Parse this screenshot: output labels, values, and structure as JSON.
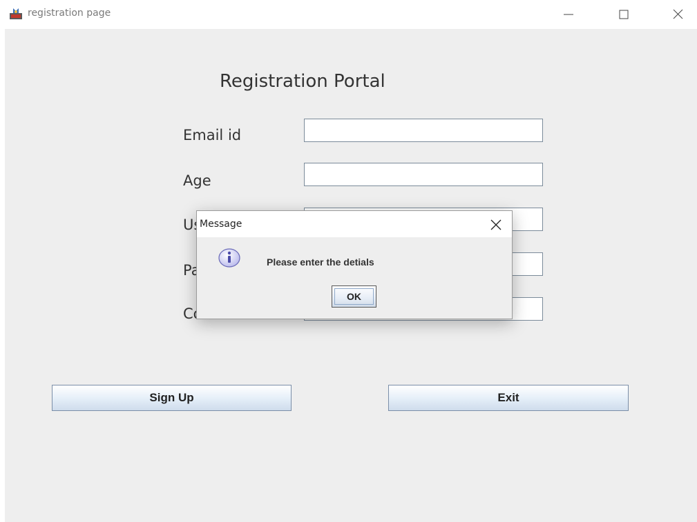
{
  "window": {
    "title": "registration page",
    "app_icon": "java-coffee-icon",
    "controls": [
      "minimize-icon",
      "maximize-icon",
      "close-icon"
    ]
  },
  "form": {
    "heading": "Registration Portal",
    "fields": [
      {
        "label": "Email id",
        "value": ""
      },
      {
        "label": "Age",
        "value": ""
      },
      {
        "label": "User Name",
        "value": ""
      },
      {
        "label": "Password",
        "value": ""
      },
      {
        "label": "Contact No",
        "value": ""
      }
    ],
    "signup_label": "Sign Up",
    "exit_label": "Exit"
  },
  "dialog": {
    "title": "Message",
    "icon": "info-icon",
    "message": "Please enter the detials",
    "ok_label": "OK"
  },
  "colors": {
    "client_background": "#eeeeee",
    "button_border": "#7a8ea8",
    "info_icon_fill": "#c8c8f0",
    "info_icon_letter": "#4a4aa8"
  }
}
